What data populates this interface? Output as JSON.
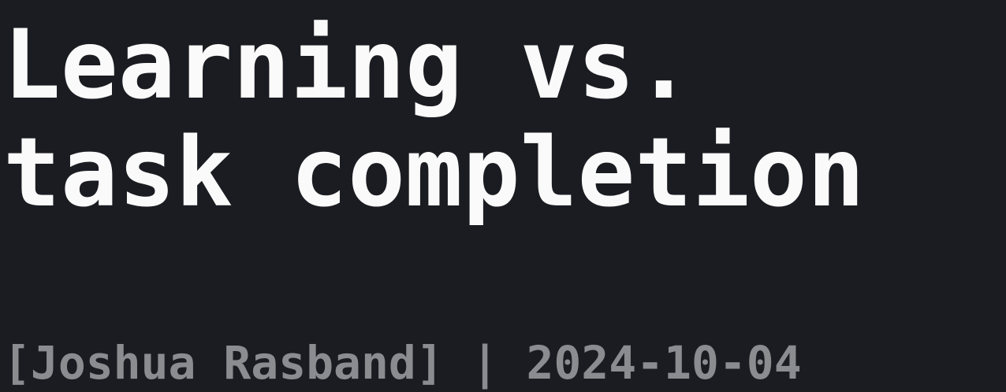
{
  "title": {
    "line1": "Learning vs.",
    "line2": "task completion"
  },
  "byline": "[Joshua Rasband] | 2024-10-04",
  "colors": {
    "background": "#1b1c21",
    "title": "#fafafa",
    "byline": "#8b8c90"
  }
}
